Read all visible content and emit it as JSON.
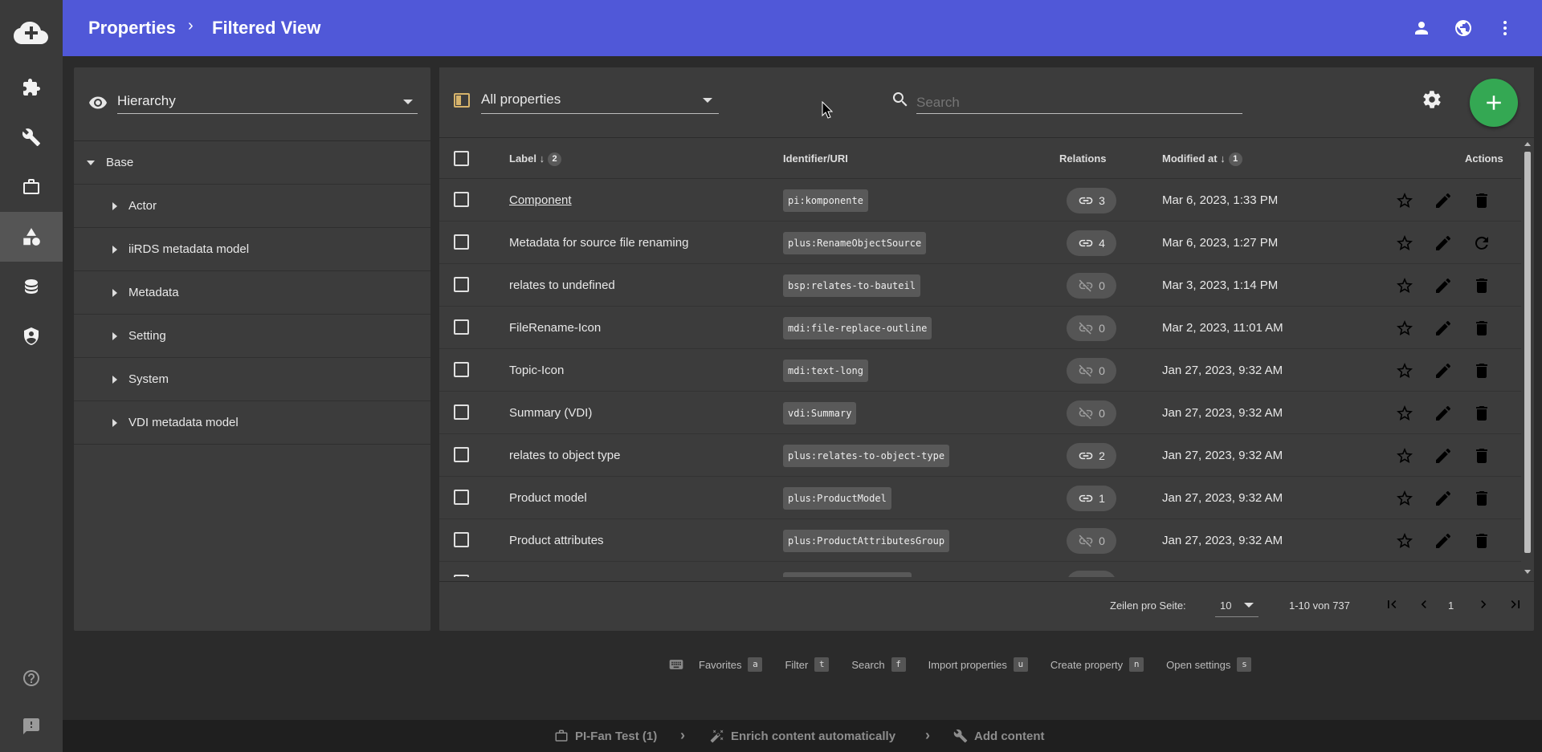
{
  "header": {
    "crumb_parent": "Properties",
    "crumb_current": "Filtered View"
  },
  "hierarchy": {
    "select_value": "Hierarchy",
    "root": "Base",
    "items": [
      "Actor",
      "iiRDS metadata model",
      "Metadata",
      "Setting",
      "System",
      "VDI metadata model"
    ]
  },
  "toolbar": {
    "filter_value": "All properties",
    "search_placeholder": "Search"
  },
  "table": {
    "headers": {
      "label": "Label",
      "label_sort": "2",
      "uri": "Identifier/URI",
      "relations": "Relations",
      "modified": "Modified at",
      "modified_sort": "1",
      "actions": "Actions"
    },
    "rows": [
      {
        "label": "Component",
        "uri": "pi:komponente",
        "rel": "3",
        "rel_active": true,
        "modified": "Mar 6, 2023, 1:33 PM",
        "third_action": "delete",
        "enabled": true
      },
      {
        "label": "Metadata for source file renaming",
        "uri": "plus:RenameObjectSource",
        "rel": "4",
        "rel_active": true,
        "modified": "Mar 6, 2023, 1:27 PM",
        "third_action": "restore",
        "enabled": true
      },
      {
        "label": "relates to undefined",
        "uri": "bsp:relates-to-bauteil",
        "rel": "0",
        "rel_active": false,
        "modified": "Mar 3, 2023, 1:14 PM",
        "third_action": "delete",
        "enabled": true
      },
      {
        "label": "FileRename-Icon",
        "uri": "mdi:file-replace-outline",
        "rel": "0",
        "rel_active": false,
        "modified": "Mar 2, 2023, 11:01 AM",
        "third_action": "delete",
        "enabled": false
      },
      {
        "label": "Topic-Icon",
        "uri": "mdi:text-long",
        "rel": "0",
        "rel_active": false,
        "modified": "Jan 27, 2023, 9:32 AM",
        "third_action": "delete",
        "enabled": false
      },
      {
        "label": "Summary (VDI)",
        "uri": "vdi:Summary",
        "rel": "0",
        "rel_active": false,
        "modified": "Jan 27, 2023, 9:32 AM",
        "third_action": "delete",
        "enabled": false
      },
      {
        "label": "relates to object type",
        "uri": "plus:relates-to-object-type",
        "rel": "2",
        "rel_active": true,
        "modified": "Jan 27, 2023, 9:32 AM",
        "third_action": "delete",
        "enabled": false
      },
      {
        "label": "Product model",
        "uri": "plus:ProductModel",
        "rel": "1",
        "rel_active": true,
        "modified": "Jan 27, 2023, 9:32 AM",
        "third_action": "delete",
        "enabled": false
      },
      {
        "label": "Product attributes",
        "uri": "plus:ProductAttributesGroup",
        "rel": "0",
        "rel_active": false,
        "modified": "Jan 27, 2023, 9:32 AM",
        "third_action": "delete",
        "enabled": false
      }
    ]
  },
  "pager": {
    "rows_label": "Zeilen pro Seite:",
    "rows_value": "10",
    "range": "1-10 von 737",
    "page": "1"
  },
  "shortcuts": [
    {
      "label": "Favorites",
      "key": "a"
    },
    {
      "label": "Filter",
      "key": "t"
    },
    {
      "label": "Search",
      "key": "f"
    },
    {
      "label": "Import properties",
      "key": "u"
    },
    {
      "label": "Create property",
      "key": "n"
    },
    {
      "label": "Open settings",
      "key": "s"
    }
  ],
  "bottombar": {
    "workspace": "PI-Fan Test (1)",
    "enrich": "Enrich content automatically",
    "add": "Add content"
  },
  "colors": {
    "topbar": "#5058d8",
    "add_button": "#34a853",
    "filter_icon": "#d6b36b"
  }
}
